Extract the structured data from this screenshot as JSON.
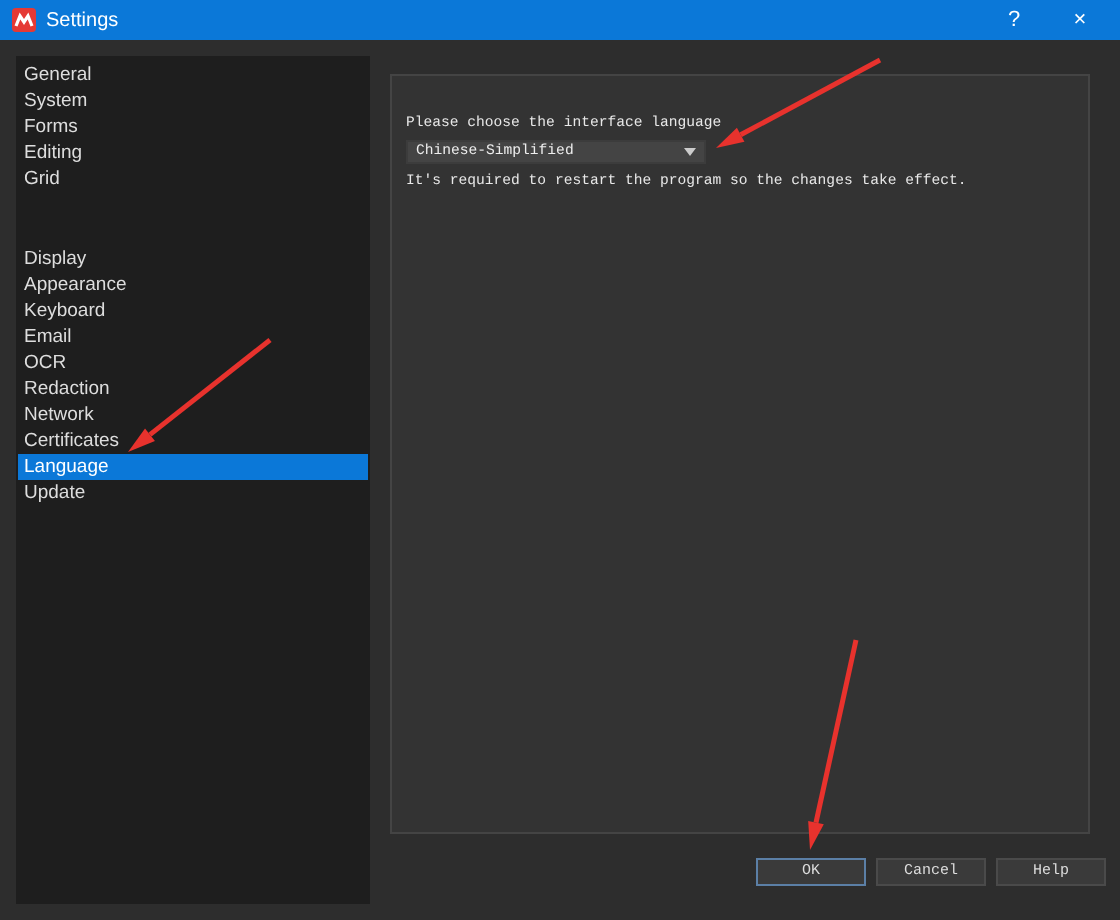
{
  "window": {
    "title": "Settings",
    "help": "?",
    "close": "×"
  },
  "sidebar": {
    "groups": [
      {
        "items": [
          {
            "label": "General",
            "selected": false
          },
          {
            "label": "System",
            "selected": false
          },
          {
            "label": "Forms",
            "selected": false
          },
          {
            "label": "Editing",
            "selected": false
          },
          {
            "label": "Grid",
            "selected": false
          }
        ]
      },
      {
        "items": [
          {
            "label": "Display",
            "selected": false
          },
          {
            "label": "Appearance",
            "selected": false
          },
          {
            "label": "Keyboard",
            "selected": false
          },
          {
            "label": "Email",
            "selected": false
          },
          {
            "label": "OCR",
            "selected": false
          },
          {
            "label": "Redaction",
            "selected": false
          },
          {
            "label": "Network",
            "selected": false
          },
          {
            "label": "Certificates",
            "selected": false
          },
          {
            "label": "Language",
            "selected": true
          },
          {
            "label": "Update",
            "selected": false
          }
        ]
      }
    ]
  },
  "panel": {
    "prompt": "Please choose the interface language",
    "language": "Chinese-Simplified",
    "note": "It's required to restart the program so the changes take effect."
  },
  "buttons": [
    "OK",
    "Cancel",
    "Help"
  ]
}
